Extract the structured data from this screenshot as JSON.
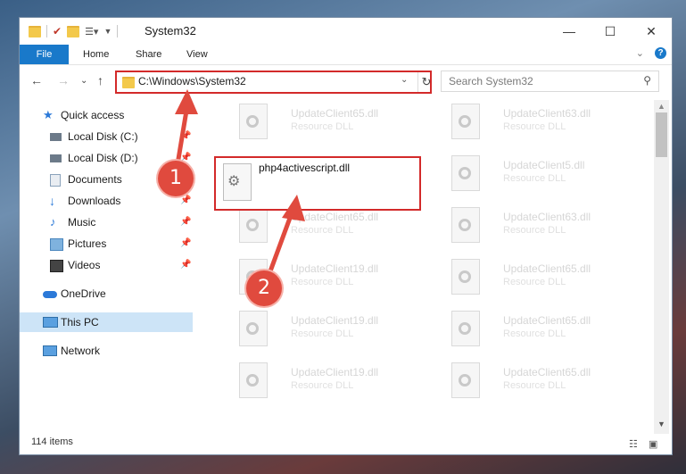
{
  "titlebar": {
    "title": "System32",
    "minimize": "—",
    "maximize": "☐",
    "close": "✕"
  },
  "ribbon": {
    "tabs": [
      "File",
      "Home",
      "Share",
      "View"
    ],
    "collapse": "⌄",
    "help": "?"
  },
  "nav": {
    "address": "C:\\Windows\\System32",
    "search_placeholder": "Search System32"
  },
  "sidebar": {
    "items": [
      {
        "label": "Quick access",
        "icon": "star-icon",
        "pinned": false
      },
      {
        "label": "Local Disk (C:)",
        "icon": "drive-icon",
        "pinned": true
      },
      {
        "label": "Local Disk (D:)",
        "icon": "drive-icon",
        "pinned": true
      },
      {
        "label": "Documents",
        "icon": "documents-icon",
        "pinned": true
      },
      {
        "label": "Downloads",
        "icon": "downloads-icon",
        "pinned": true
      },
      {
        "label": "Music",
        "icon": "music-icon",
        "pinned": true
      },
      {
        "label": "Pictures",
        "icon": "pictures-icon",
        "pinned": true
      },
      {
        "label": "Videos",
        "icon": "videos-icon",
        "pinned": true
      },
      {
        "label": "OneDrive",
        "icon": "onedrive-icon",
        "pinned": false
      },
      {
        "label": "This PC",
        "icon": "computer-icon",
        "pinned": false
      },
      {
        "label": "Network",
        "icon": "network-icon",
        "pinned": false
      }
    ]
  },
  "files": [
    {
      "name": "UpdateClient65.dll",
      "type": "Resource DLL"
    },
    {
      "name": "UpdateClient63.dll",
      "type": "Resource DLL"
    },
    {
      "name": "UpdateClient5.dll",
      "type": "Resource DLL"
    },
    {
      "name": "UpdateClient65.dll",
      "type": "Resource DLL"
    },
    {
      "name": "UpdateClient63.dll",
      "type": "Resource DLL"
    },
    {
      "name": "UpdateClient19.dll",
      "type": "Resource DLL"
    },
    {
      "name": "UpdateClient65.dll",
      "type": "Resource DLL"
    },
    {
      "name": "UpdateClient19.dll",
      "type": "Resource DLL"
    },
    {
      "name": "UpdateClient65.dll",
      "type": "Resource DLL"
    },
    {
      "name": "UpdateClient19.dll",
      "type": "Resource DLL"
    },
    {
      "name": "UpdateClient65.dll",
      "type": "Resource DLL"
    }
  ],
  "featured_file": {
    "name": "php4activescript.dll"
  },
  "status": {
    "item_count": "114 items"
  },
  "annotations": {
    "step1": "1",
    "step2": "2"
  },
  "colors": {
    "accent": "#1979ca",
    "highlight": "#d32a2a",
    "badge": "#e04a3e"
  }
}
